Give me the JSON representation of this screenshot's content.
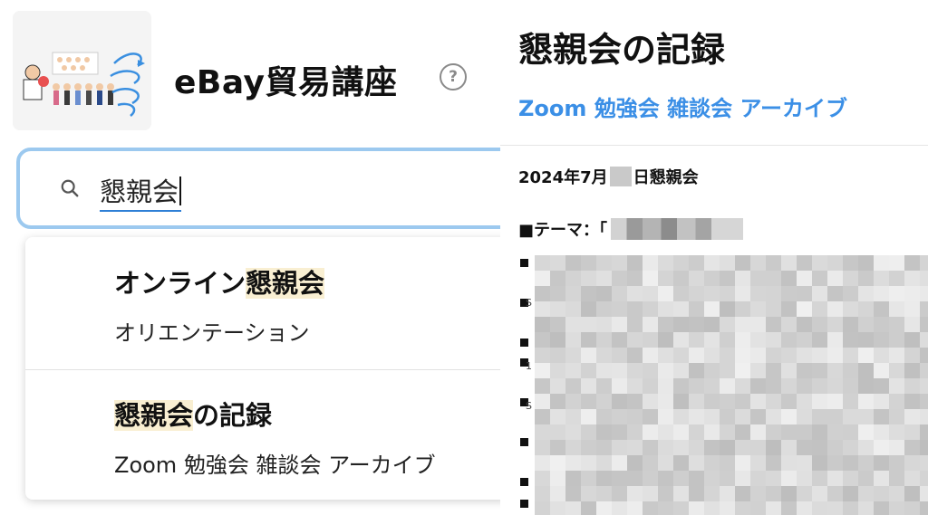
{
  "app": {
    "title": "eBay貿易講座",
    "help_symbol": "?"
  },
  "search": {
    "query": "懇親会"
  },
  "suggestions": [
    {
      "title_prefix": "オンライン",
      "title_highlight": "懇親会",
      "title_suffix": "",
      "subtitle": "オリエンテーション"
    },
    {
      "title_prefix": "",
      "title_highlight": "懇親会",
      "title_suffix": "の記録",
      "subtitle": "Zoom 勉強会 雑談会 アーカイブ"
    }
  ],
  "document": {
    "title": "懇親会の記録",
    "subtitle": "Zoom 勉強会 雑談会 アーカイブ",
    "date_prefix": "2024年7月",
    "date_suffix": "日懇親会",
    "theme_label": "■テーマ：「",
    "side_chars": [
      "S",
      "1",
      "S"
    ]
  },
  "colors": {
    "accent": "#3b8fe6",
    "search_border": "#9cc9ef",
    "highlight": "#f9efd2"
  }
}
